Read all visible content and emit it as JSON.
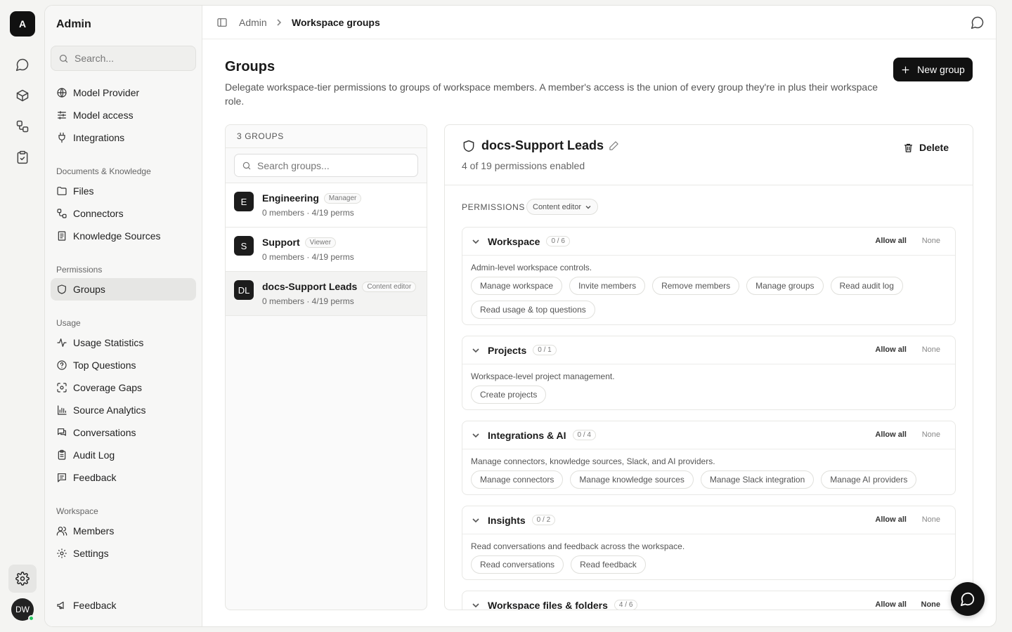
{
  "rail": {
    "logo": "A",
    "avatar": "DW"
  },
  "sidebar": {
    "title": "Admin",
    "search_placeholder": "Search...",
    "items_top": [
      {
        "label": "Model Provider",
        "icon": "globe-icon"
      },
      {
        "label": "Model access",
        "icon": "sliders-icon"
      },
      {
        "label": "Integrations",
        "icon": "plug-icon"
      }
    ],
    "sections": [
      {
        "title": "Documents & Knowledge",
        "items": [
          {
            "label": "Files",
            "icon": "folder-icon"
          },
          {
            "label": "Connectors",
            "icon": "connector-icon"
          },
          {
            "label": "Knowledge Sources",
            "icon": "book-icon"
          }
        ]
      },
      {
        "title": "Permissions",
        "items": [
          {
            "label": "Groups",
            "icon": "shield-icon",
            "active": true
          }
        ]
      },
      {
        "title": "Usage",
        "items": [
          {
            "label": "Usage Statistics",
            "icon": "activity-icon"
          },
          {
            "label": "Top Questions",
            "icon": "help-circle-icon"
          },
          {
            "label": "Coverage Gaps",
            "icon": "scan-icon"
          },
          {
            "label": "Source Analytics",
            "icon": "bar-chart-icon"
          },
          {
            "label": "Conversations",
            "icon": "messages-icon"
          },
          {
            "label": "Audit Log",
            "icon": "clipboard-icon"
          },
          {
            "label": "Feedback",
            "icon": "message-square-icon"
          }
        ]
      },
      {
        "title": "Workspace",
        "items": [
          {
            "label": "Members",
            "icon": "users-icon"
          },
          {
            "label": "Settings",
            "icon": "gear-icon"
          }
        ]
      }
    ],
    "footer_item": {
      "label": "Feedback",
      "icon": "megaphone-icon"
    }
  },
  "topbar": {
    "breadcrumb_parent": "Admin",
    "breadcrumb_current": "Workspace groups"
  },
  "main": {
    "title": "Groups",
    "description": "Delegate workspace-tier permissions to groups of workspace members. A member's access is the union of every group they're in plus their workspace role.",
    "new_button": "New group"
  },
  "groups": {
    "count_label": "3 GROUPS",
    "search_placeholder": "Search groups...",
    "list": [
      {
        "initials": "E",
        "name": "Engineering",
        "role": "Manager",
        "meta": "0 members · 4/19 perms"
      },
      {
        "initials": "S",
        "name": "Support",
        "role": "Viewer",
        "meta": "0 members · 4/19 perms"
      },
      {
        "initials": "DL",
        "name": "docs-Support Leads",
        "role": "Content editor",
        "meta": "0 members · 4/19 perms",
        "selected": true
      }
    ]
  },
  "detail": {
    "name": "docs-Support Leads",
    "subtitle": "4 of 19 permissions enabled",
    "delete_label": "Delete",
    "permissions_label": "PERMISSIONS",
    "role_select": "Content editor",
    "allow_all_label": "Allow all",
    "none_label": "None",
    "categories": [
      {
        "name": "Workspace",
        "count": "0 / 6",
        "description": "Admin-level workspace controls.",
        "permissions": [
          "Manage workspace",
          "Invite members",
          "Remove members",
          "Manage groups",
          "Read audit log",
          "Read usage & top questions"
        ]
      },
      {
        "name": "Projects",
        "count": "0 / 1",
        "description": "Workspace-level project management.",
        "permissions": [
          "Create projects"
        ]
      },
      {
        "name": "Integrations & AI",
        "count": "0 / 4",
        "description": "Manage connectors, knowledge sources, Slack, and AI providers.",
        "permissions": [
          "Manage connectors",
          "Manage knowledge sources",
          "Manage Slack integration",
          "Manage AI providers"
        ]
      },
      {
        "name": "Insights",
        "count": "0 / 2",
        "description": "Read conversations and feedback across the workspace.",
        "permissions": [
          "Read conversations",
          "Read feedback"
        ]
      },
      {
        "name": "Workspace files & folders",
        "count": "4 / 6"
      }
    ]
  }
}
